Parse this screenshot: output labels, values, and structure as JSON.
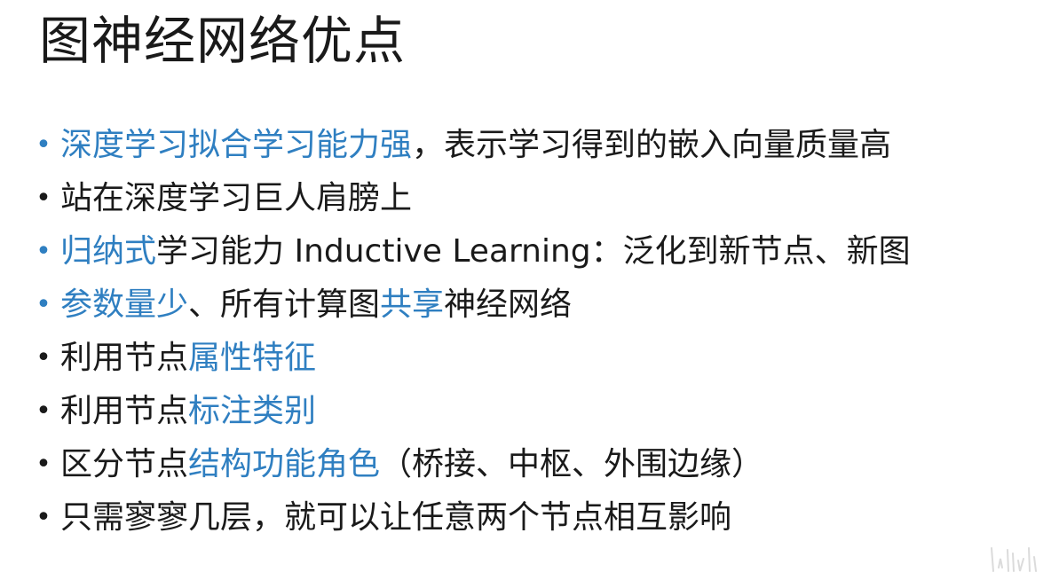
{
  "title": "图神经网络优点",
  "colors": {
    "accent": "#2f7fc1",
    "text": "#1a1a1a",
    "background": "#ffffff"
  },
  "bullets": [
    {
      "dot_color": "accent",
      "segments": [
        {
          "text": "深度学习拟合学习能力强",
          "highlight": true
        },
        {
          "text": "，表示学习得到的嵌入向量质量高",
          "highlight": false
        }
      ]
    },
    {
      "dot_color": "plain",
      "segments": [
        {
          "text": "站在深度学习巨人肩膀上",
          "highlight": false
        }
      ]
    },
    {
      "dot_color": "accent",
      "segments": [
        {
          "text": "归纳式",
          "highlight": true
        },
        {
          "text": "学习能力 Inductive Learning：泛化到新节点、新图",
          "highlight": false
        }
      ]
    },
    {
      "dot_color": "accent",
      "segments": [
        {
          "text": "参数量少",
          "highlight": true
        },
        {
          "text": "、所有计算图",
          "highlight": false
        },
        {
          "text": "共享",
          "highlight": true
        },
        {
          "text": "神经网络",
          "highlight": false
        }
      ]
    },
    {
      "dot_color": "plain",
      "segments": [
        {
          "text": "利用节点",
          "highlight": false
        },
        {
          "text": "属性特征",
          "highlight": true
        }
      ]
    },
    {
      "dot_color": "plain",
      "segments": [
        {
          "text": "利用节点",
          "highlight": false
        },
        {
          "text": "标注类别",
          "highlight": true
        }
      ]
    },
    {
      "dot_color": "plain",
      "segments": [
        {
          "text": "区分节点",
          "highlight": false
        },
        {
          "text": "结构功能角色",
          "highlight": true
        },
        {
          "text": "（桥接、中枢、外围边缘）",
          "highlight": false
        }
      ]
    },
    {
      "dot_color": "plain",
      "segments": [
        {
          "text": "只需寥寥几层，就可以让任意两个节点相互影响",
          "highlight": false
        }
      ]
    }
  ]
}
